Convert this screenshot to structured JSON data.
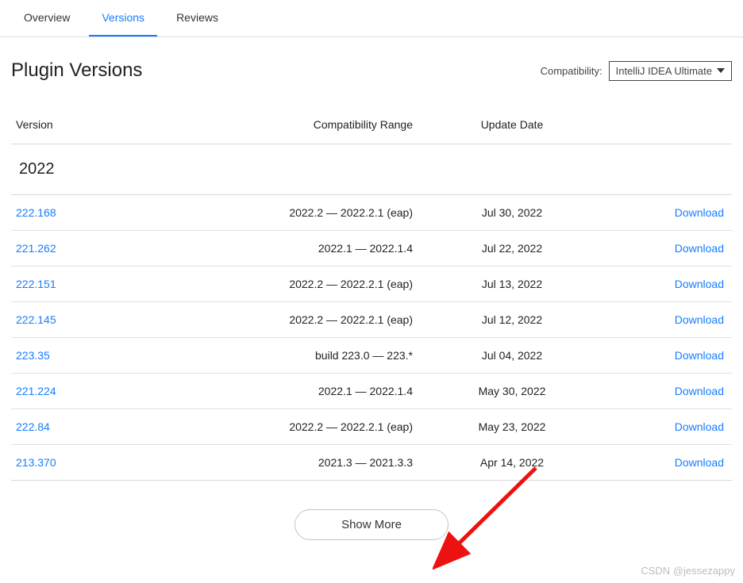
{
  "tabs": {
    "overview": "Overview",
    "versions": "Versions",
    "reviews": "Reviews"
  },
  "page_title": "Plugin Versions",
  "compatibility": {
    "label": "Compatibility:",
    "selected": "IntelliJ IDEA Ultimate"
  },
  "columns": {
    "version": "Version",
    "compat": "Compatibility Range",
    "date": "Update Date"
  },
  "group_year": "2022",
  "download_label": "Download",
  "rows": [
    {
      "version": "222.168",
      "compat": "2022.2 — 2022.2.1 (eap)",
      "date": "Jul 30, 2022"
    },
    {
      "version": "221.262",
      "compat": "2022.1 — 2022.1.4",
      "date": "Jul 22, 2022"
    },
    {
      "version": "222.151",
      "compat": "2022.2 — 2022.2.1 (eap)",
      "date": "Jul 13, 2022"
    },
    {
      "version": "222.145",
      "compat": "2022.2 — 2022.2.1 (eap)",
      "date": "Jul 12, 2022"
    },
    {
      "version": "223.35",
      "compat": "build 223.0 — 223.*",
      "date": "Jul 04, 2022"
    },
    {
      "version": "221.224",
      "compat": "2022.1 — 2022.1.4",
      "date": "May 30, 2022"
    },
    {
      "version": "222.84",
      "compat": "2022.2 — 2022.2.1 (eap)",
      "date": "May 23, 2022"
    },
    {
      "version": "213.370",
      "compat": "2021.3 — 2021.3.3",
      "date": "Apr 14, 2022"
    }
  ],
  "show_more": "Show More",
  "watermark": "CSDN @jessezappy"
}
